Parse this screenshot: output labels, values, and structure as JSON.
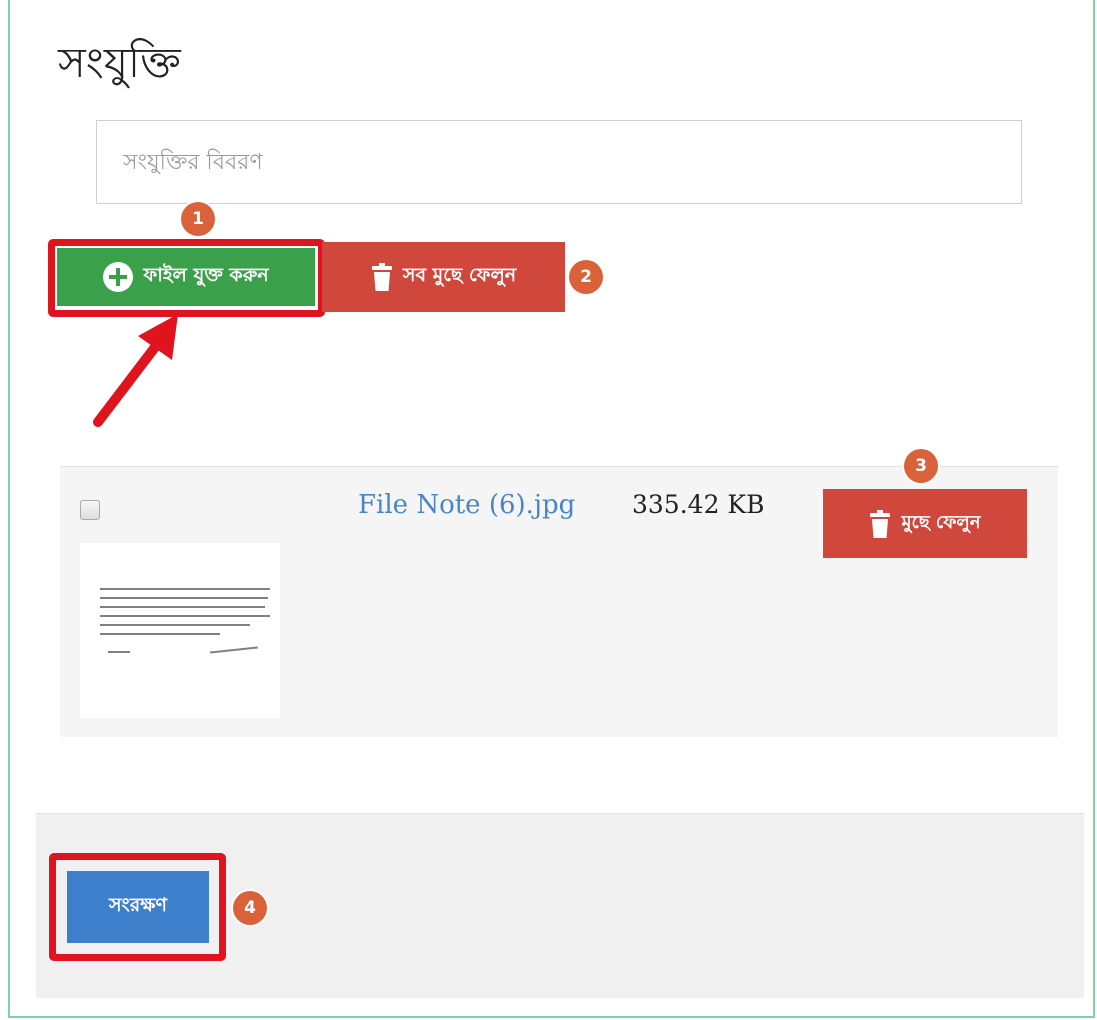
{
  "section": {
    "title": "সংযুক্তি",
    "description_placeholder": "সংযুক্তির বিবরণ"
  },
  "toolbar": {
    "add_file_label": "ফাইল যুক্ত করুন",
    "delete_all_label": "সব মুছে ফেলুন"
  },
  "file": {
    "name": "File Note (6).jpg",
    "size": "335.42 KB",
    "delete_label": "মুছে ফেলুন"
  },
  "footer": {
    "save_label": "সংরক্ষণ"
  },
  "badges": {
    "b1": "1",
    "b2": "2",
    "b3": "3",
    "b4": "4"
  },
  "colors": {
    "add_button": "#3aa04a",
    "delete_button": "#d0483b",
    "save_button": "#3e7fcb",
    "highlight": "#e0141e",
    "badge": "#d9623b",
    "file_link": "#4a86c5"
  },
  "icons": [
    "plus-circle-icon",
    "trash-icon",
    "arrow-icon"
  ]
}
